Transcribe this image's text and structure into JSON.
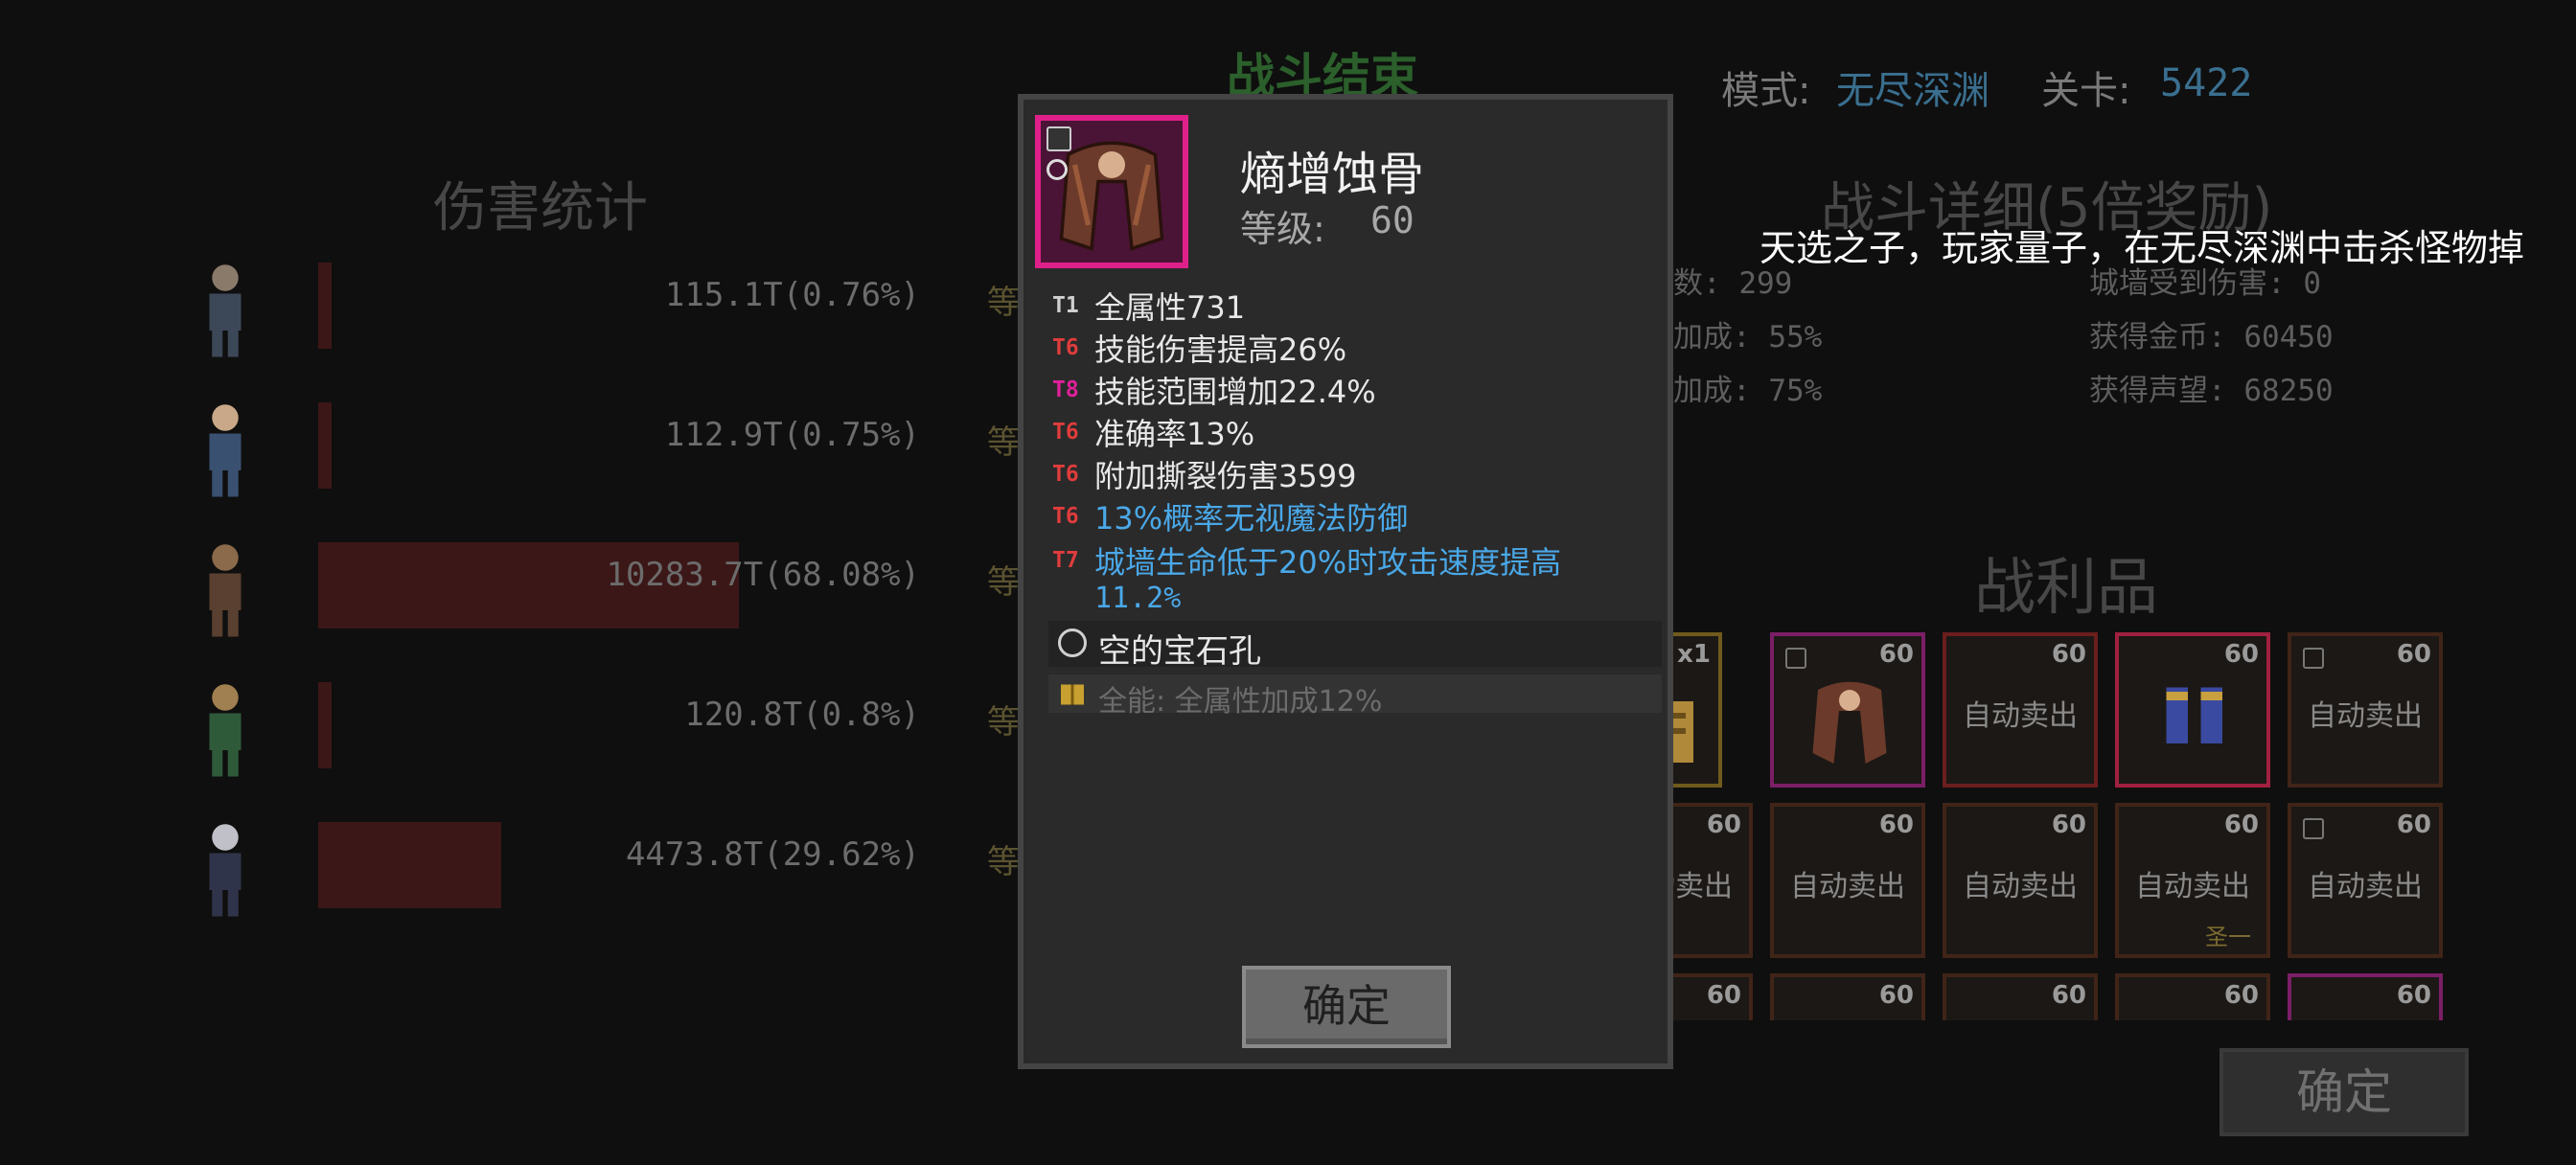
{
  "header": {
    "title": "战斗结束",
    "mode_label": "模式:",
    "mode_value": "无尽深渊",
    "level_label": "关卡:",
    "level_value": "5422"
  },
  "damage_stats": {
    "heading": "伤害统计",
    "heroes": [
      {
        "damage": "115.1T(0.76%)",
        "share": 0.0076,
        "grade": "等"
      },
      {
        "damage": "112.9T(0.75%)",
        "share": 0.0075,
        "grade": "等"
      },
      {
        "damage": "10283.7T(68.08%)",
        "share": 0.6808,
        "grade": "等"
      },
      {
        "damage": "120.8T(0.8%)",
        "share": 0.008,
        "grade": "等"
      },
      {
        "damage": "4473.8T(29.62%)",
        "share": 0.2962,
        "grade": "等"
      }
    ]
  },
  "battle_details": {
    "heading": "战斗详细(5倍奖励)",
    "left": [
      "数: 299",
      "加成: 55%",
      "加成: 75%"
    ],
    "right": [
      "城墙受到伤害: 0",
      "获得金币: 60450",
      "获得声望: 68250"
    ]
  },
  "banner": "天选之子，玩家量子，在无尽深渊中击杀怪物掉",
  "loot": {
    "heading": "战利品",
    "auto_sell": "自动卖出",
    "row1": [
      {
        "badge": "x1",
        "auto": false,
        "frame": "gold"
      },
      {
        "badge": "60",
        "auto": false,
        "frame": "magenta"
      },
      {
        "badge": "60",
        "auto": true,
        "frame": "red"
      },
      {
        "badge": "60",
        "auto": false,
        "frame": "red"
      },
      {
        "badge": "60",
        "auto": true,
        "frame": "brown"
      }
    ],
    "row2": [
      {
        "badge": "60",
        "auto": true,
        "text": "卖出"
      },
      {
        "badge": "60",
        "auto": true
      },
      {
        "badge": "60",
        "auto": true
      },
      {
        "badge": "60",
        "auto": true,
        "sub": "圣一"
      },
      {
        "badge": "60",
        "auto": true
      }
    ],
    "row3": [
      "60",
      "60",
      "60",
      "60",
      "60"
    ]
  },
  "bg_confirm": "确定",
  "item": {
    "name": "熵增蚀骨",
    "level_label": "等级:",
    "level_value": "60",
    "affixes": [
      {
        "tier": "T1",
        "text": "全属性731",
        "tier_color": "#cfcfcf",
        "text_color": "#e8e8e8"
      },
      {
        "tier": "T6",
        "text": "技能伤害提高26%",
        "tier_color": "#e03c3c",
        "text_color": "#e8e8e8"
      },
      {
        "tier": "T8",
        "text": "技能范围增加22.4%",
        "tier_color": "#e0209a",
        "text_color": "#e8e8e8"
      },
      {
        "tier": "T6",
        "text": "准确率13%",
        "tier_color": "#e03c3c",
        "text_color": "#e8e8e8"
      },
      {
        "tier": "T6",
        "text": "附加撕裂伤害3599",
        "tier_color": "#e03c3c",
        "text_color": "#e8e8e8"
      },
      {
        "tier": "T6",
        "text": "13%概率无视魔法防御",
        "tier_color": "#e03c3c",
        "text_color": "#4aa8e8"
      },
      {
        "tier": "T7",
        "text": "城墙生命低于20%时攻击速度提高",
        "text2": "11.2%",
        "tier_color": "#e03c3c",
        "text_color": "#4aa8e8"
      }
    ],
    "gem_slot": "空的宝石孔",
    "set_bonus": "全能:  全属性加成12%",
    "confirm": "确定"
  }
}
